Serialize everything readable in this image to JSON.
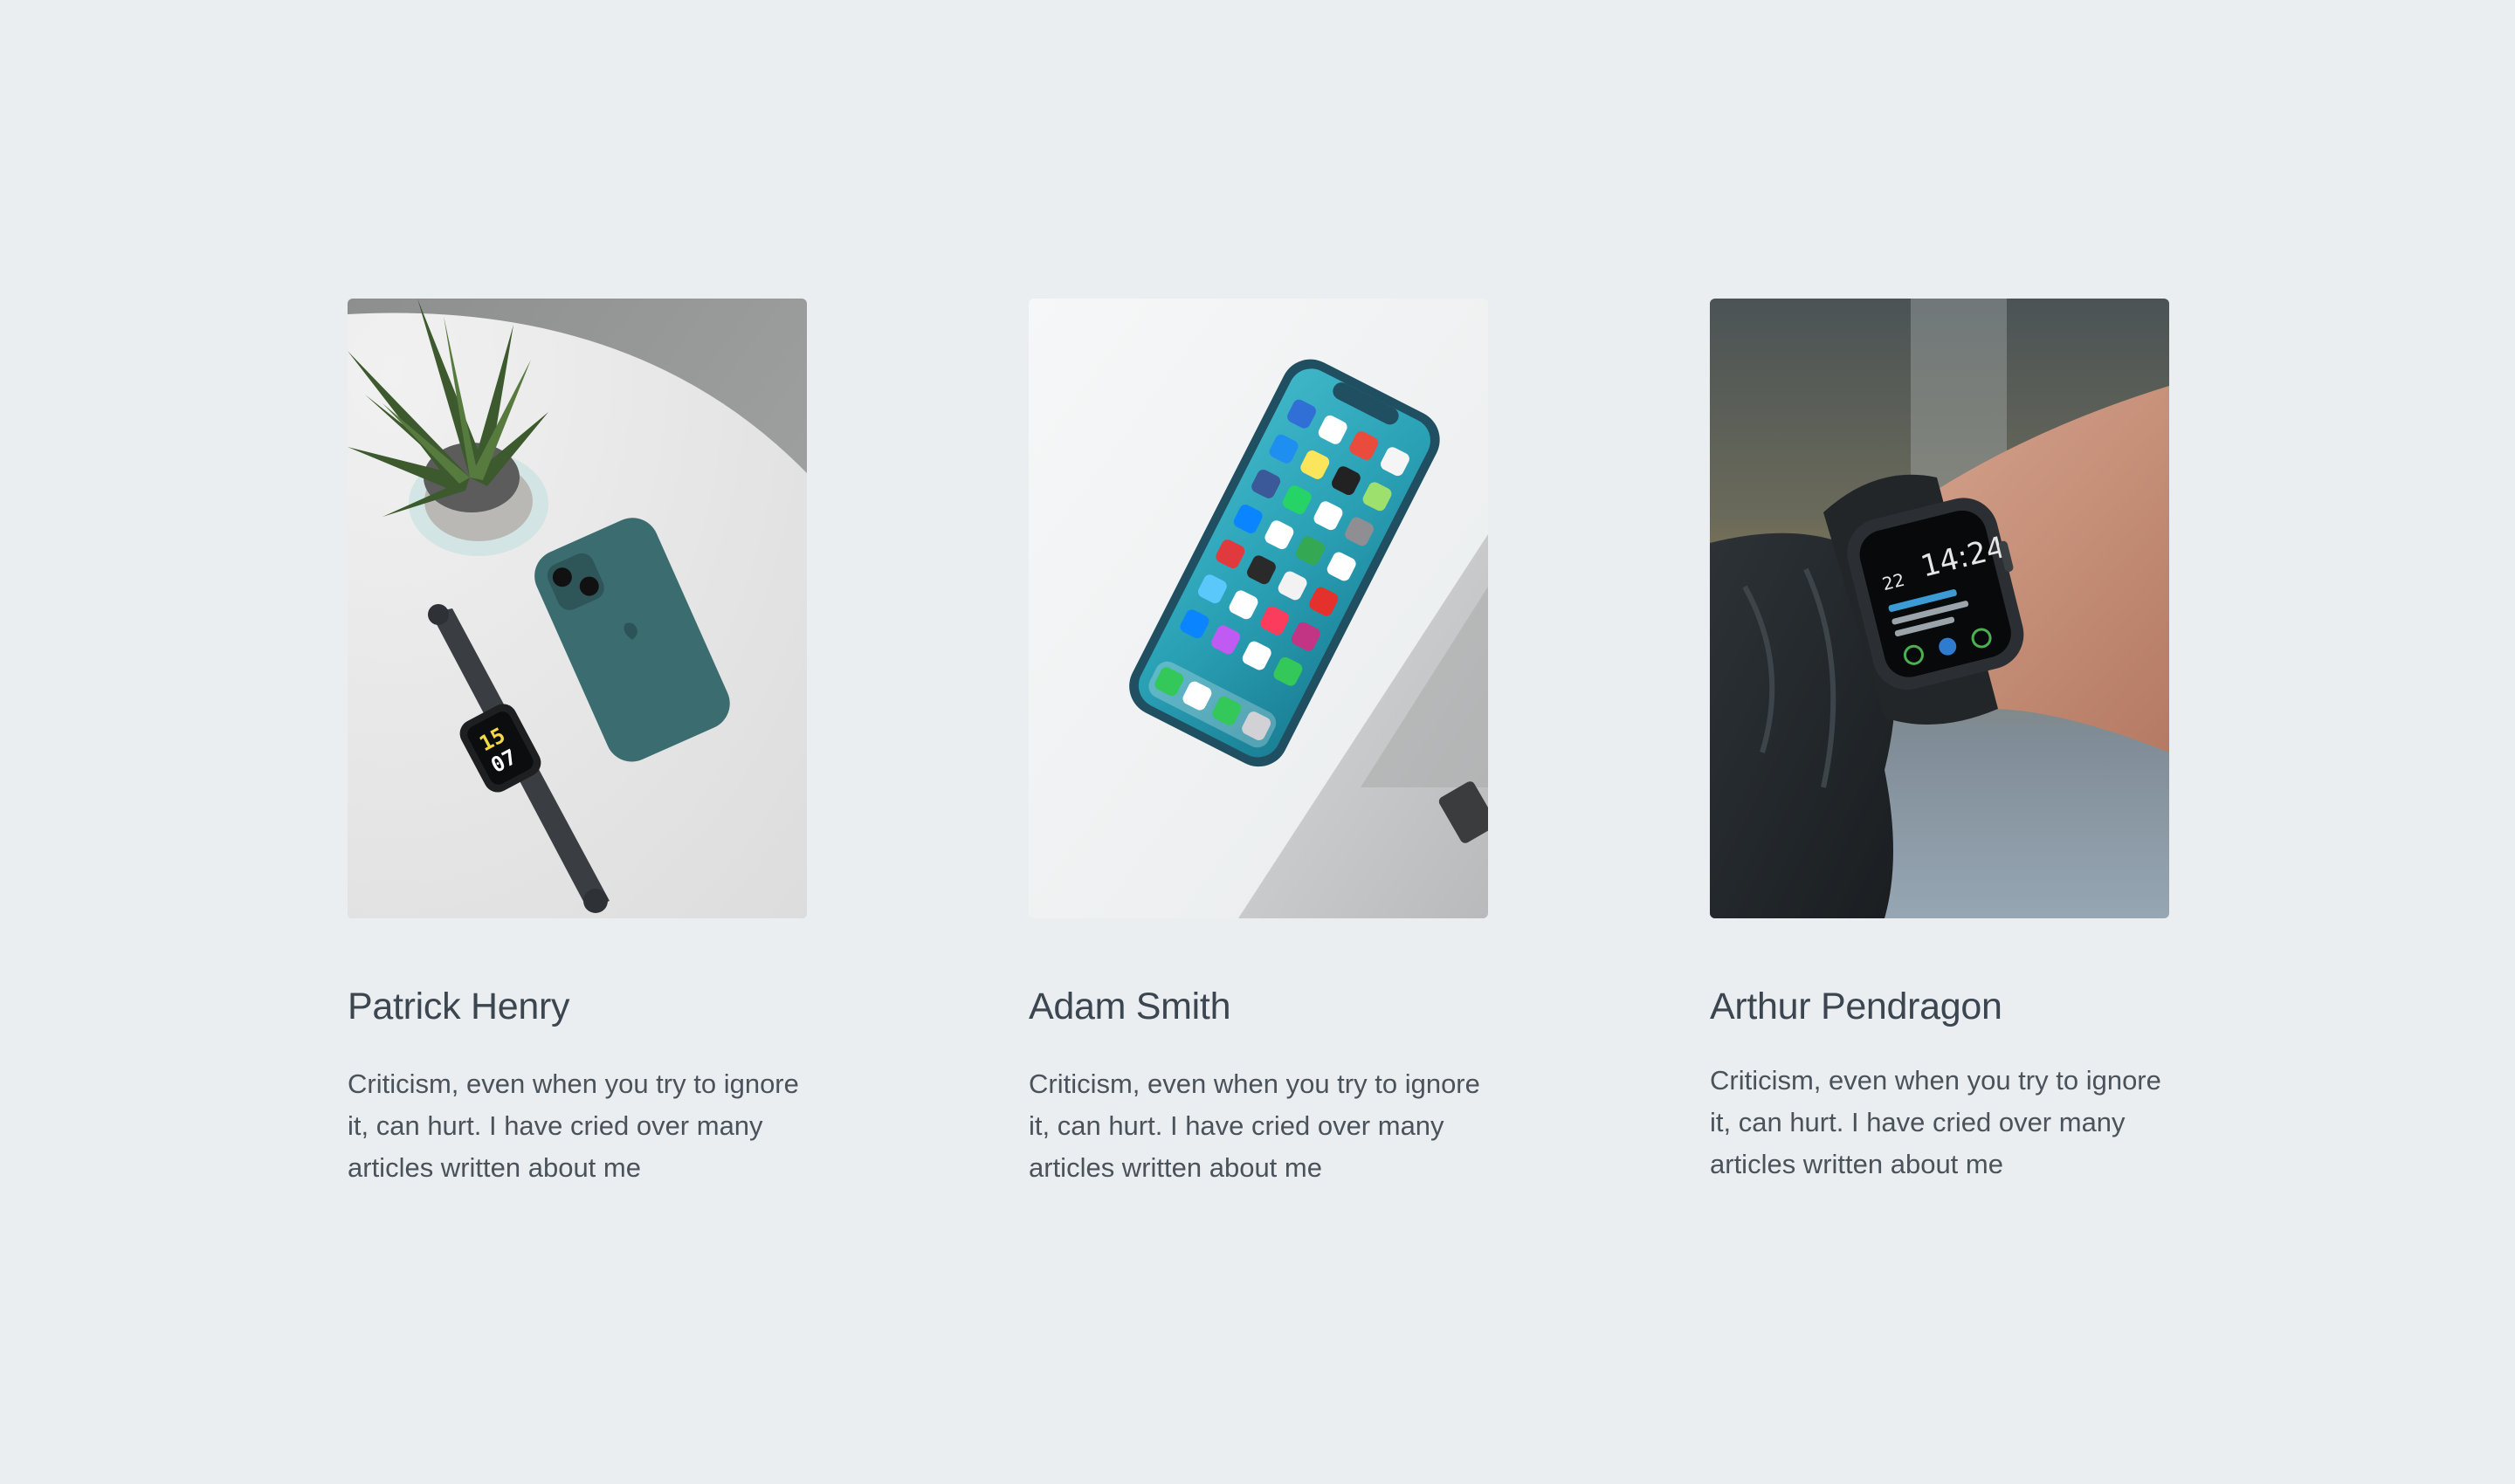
{
  "cards": [
    {
      "name": "Patrick Henry",
      "description": "Criticism, even when you try to ignore it, can hurt. I have cried over many articles written about me",
      "image": "watch-phone-plant-photo"
    },
    {
      "name": "Adam Smith",
      "description": "Criticism, even when you try to ignore it, can hurt. I have cried over many articles written about me",
      "image": "smartphone-photo"
    },
    {
      "name": "Arthur Pendragon",
      "description": "Criticism, even when you try to ignore it, can hurt. I have cried over many articles written about me",
      "image": "smartwatch-wrist-photo"
    }
  ],
  "watch_face": {
    "day": "22",
    "time": "14:24"
  },
  "colors": {
    "background": "#ebeef1",
    "title": "#3c4650",
    "text": "#4a525a"
  }
}
